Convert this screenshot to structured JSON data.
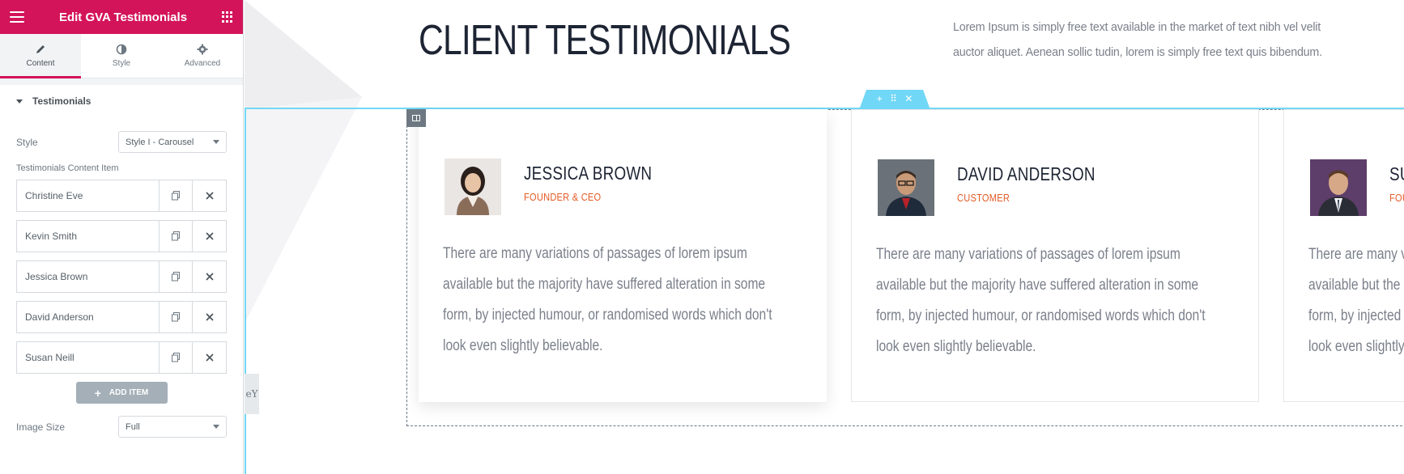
{
  "panel": {
    "title": "Edit GVA Testimonials",
    "tabs": [
      {
        "label": "Content",
        "icon": "pencil-icon"
      },
      {
        "label": "Style",
        "icon": "contrast-icon"
      },
      {
        "label": "Advanced",
        "icon": "gear-icon"
      }
    ],
    "section_title": "Testimonials",
    "style_label": "Style",
    "style_value": "Style I - Carousel",
    "content_item_label": "Testimonials Content Item",
    "items": [
      {
        "title": "Christine Eve"
      },
      {
        "title": "Kevin Smith"
      },
      {
        "title": "Jessica Brown"
      },
      {
        "title": "David Anderson"
      },
      {
        "title": "Susan Neill"
      }
    ],
    "add_item_label": "ADD ITEM",
    "add_item_icon": "+",
    "image_size_label": "Image Size",
    "image_size_value": "Full",
    "accent_color": "#d3145a"
  },
  "canvas": {
    "title": "CLIENT TESTIMONIALS",
    "intro": "Lorem Ipsum is simply free text available in the market of text nibh vel velit auctor aliquet. Aenean sollic tudin, lorem is simply free text quis bibendum.",
    "section_handle": {
      "add": "+",
      "move": "⠿",
      "close": "✕"
    },
    "side_toggle": "eY",
    "outline_color": "#71d7f7",
    "cards": [
      {
        "name": "JESSICA BROWN",
        "role": "FOUNDER & CEO",
        "quote": "There are many variations of passages of lorem ipsum available but the majority have suffered alteration in some form, by injected humour, or randomised words which don't look even slightly believable."
      },
      {
        "name": "DAVID ANDERSON",
        "role": "CUSTOMER",
        "quote": "There are many variations of passages of lorem ipsum available but the majority have suffered alteration in some form, by injected humour, or randomised words which don't look even slightly believable."
      },
      {
        "name": "SUSAN NEILL",
        "role": "FOUNDER",
        "quote": "There are many variations of passages of lorem ipsum available but the majority have suffered alteration in some form, by injected humour, or randomised words which don't look even slightly believable."
      }
    ],
    "role_color": "#e35a25"
  }
}
